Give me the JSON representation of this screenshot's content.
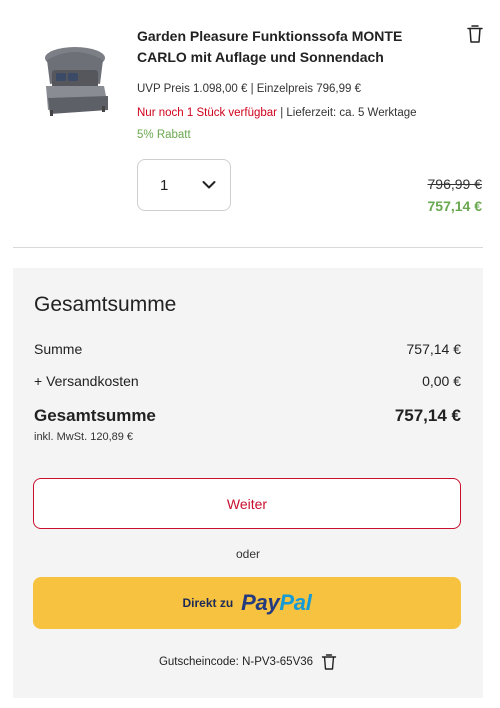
{
  "product": {
    "title": "Garden Pleasure Funktionssofa MONTE CARLO mit Auflage und Sonnendach",
    "price_line": "UVP Preis  1.098,00 € | Einzelpreis  796,99 €",
    "stock_warning": "Nur noch 1 Stück verfügbar",
    "delivery": " | Lieferzeit:  ca. 5 Werktage",
    "discount": "5% Rabatt",
    "quantity": "1",
    "old_price": "796,99 €",
    "new_price": "757,14 €",
    "image_icon": "sofa-image",
    "remove_icon": "trash-icon"
  },
  "summary": {
    "title": "Gesamtsumme",
    "rows": [
      {
        "label": "Summe",
        "amount": "757,14 €"
      },
      {
        "label": "+ Versandkosten",
        "amount": "0,00 €"
      }
    ],
    "total_label": "Gesamtsumme",
    "total_amount": "757,14 €",
    "vat_note": "inkl. MwSt. 120,89 €",
    "continue_label": "Weiter",
    "or_label": "oder",
    "paypal_lead": "Direkt zu",
    "paypal_brand_pay": "Pay",
    "paypal_brand_pal": "Pal",
    "coupon_label": "Gutscheincode: N-PV3-65V36"
  },
  "colors": {
    "accent_red": "#c8102e",
    "discount_green": "#6aa84f",
    "paypal_yellow": "#f6c23f",
    "paypal_dark_blue": "#253b80",
    "paypal_light_blue": "#179bd7"
  }
}
